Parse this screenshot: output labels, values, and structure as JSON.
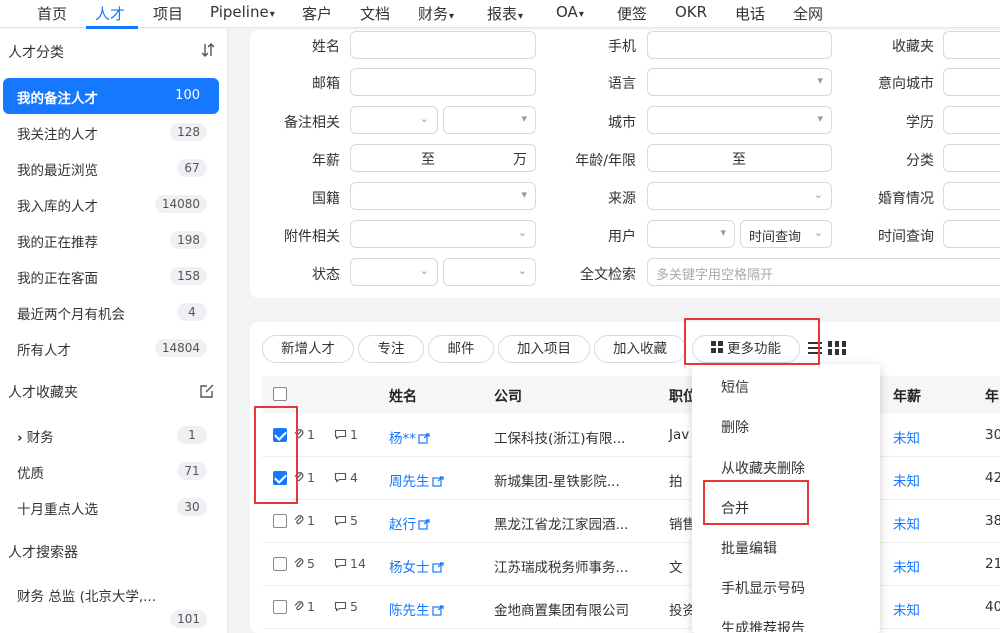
{
  "nav": {
    "items": [
      {
        "label": "首页"
      },
      {
        "label": "人才"
      },
      {
        "label": "项目"
      },
      {
        "label": "Pipeline"
      },
      {
        "label": "客户"
      },
      {
        "label": "文档"
      },
      {
        "label": "财务"
      },
      {
        "label": "报表"
      },
      {
        "label": "OA"
      },
      {
        "label": "便签"
      },
      {
        "label": "OKR"
      },
      {
        "label": "电话"
      },
      {
        "label": "全网"
      }
    ],
    "caret": "▾",
    "active_color": "#1677ff"
  },
  "sidebar": {
    "category_title": "人才分类",
    "items": [
      {
        "label": "我的备注人才",
        "count": "100"
      },
      {
        "label": "我关注的人才",
        "count": "128"
      },
      {
        "label": "我的最近浏览",
        "count": "67"
      },
      {
        "label": "我入库的人才",
        "count": "14080"
      },
      {
        "label": "我的正在推荐",
        "count": "198"
      },
      {
        "label": "我的正在客面",
        "count": "158"
      },
      {
        "label": "最近两个月有机会",
        "count": "4"
      },
      {
        "label": "所有人才",
        "count": "14804"
      }
    ],
    "fav_title": "人才收藏夹",
    "fav_items": [
      {
        "label": "财务",
        "count": "1",
        "chevron": "›"
      },
      {
        "label": "优质",
        "count": "71"
      },
      {
        "label": "十月重点人选",
        "count": "30"
      }
    ],
    "search_title": "人才搜索器",
    "search_items": [
      {
        "label": "财务 总监 (北京大学,...",
        "count": "101"
      }
    ]
  },
  "filter": {
    "labels": {
      "name": "姓名",
      "phone": "手机",
      "favorites": "收藏夹",
      "email": "邮箱",
      "language": "语言",
      "intent_city": "意向城市",
      "note": "备注相关",
      "city": "城市",
      "education": "学历",
      "salary": "年薪",
      "age": "年龄/年限",
      "category": "分类",
      "nationality": "国籍",
      "source": "来源",
      "marital": "婚育情况",
      "attachment": "附件相关",
      "user": "用户",
      "time_range": "时间查询",
      "status": "状态",
      "fulltext": "全文检索"
    },
    "to_label": "至",
    "wan_label": "万",
    "time_select": "时间查询",
    "fulltext_placeholder": "多关键字用空格隔开"
  },
  "toolbar": {
    "buttons": [
      "新增人才",
      "专注",
      "邮件",
      "加入项目",
      "加入收藏"
    ],
    "more_label": "更多功能"
  },
  "table": {
    "headers": {
      "name": "姓名",
      "company": "公司",
      "position": "职位",
      "salary": "年薪",
      "extra": "年"
    },
    "rows": [
      {
        "checked": true,
        "attach": "1",
        "comment": "1",
        "name": "杨**",
        "company": "工保科技(浙江)有限...",
        "position": "Jav",
        "salary": "未知",
        "age": "30"
      },
      {
        "checked": true,
        "attach": "1",
        "comment": "4",
        "name": "周先生",
        "company": "新城集团-星铁影院...",
        "position": "拍",
        "salary": "未知",
        "age": "42"
      },
      {
        "checked": false,
        "attach": "1",
        "comment": "5",
        "name": "赵行",
        "company": "黑龙江省龙江家园酒...",
        "position": "销售",
        "salary": "未知",
        "age": "38"
      },
      {
        "checked": false,
        "attach": "5",
        "comment": "14",
        "name": "杨女士",
        "company": "江苏瑞成税务师事务...",
        "position": "文",
        "salary": "未知",
        "age": "21"
      },
      {
        "checked": false,
        "attach": "1",
        "comment": "5",
        "name": "陈先生",
        "company": "金地商置集团有限公司",
        "position": "投资",
        "salary": "未知",
        "age": "40"
      }
    ]
  },
  "menu": {
    "items": [
      "短信",
      "删除",
      "从收藏夹删除",
      "合并",
      "批量编辑",
      "手机显示号码",
      "生成推荐报告"
    ]
  },
  "colors": {
    "accent": "#1677ff",
    "highlight": "#e53935"
  }
}
